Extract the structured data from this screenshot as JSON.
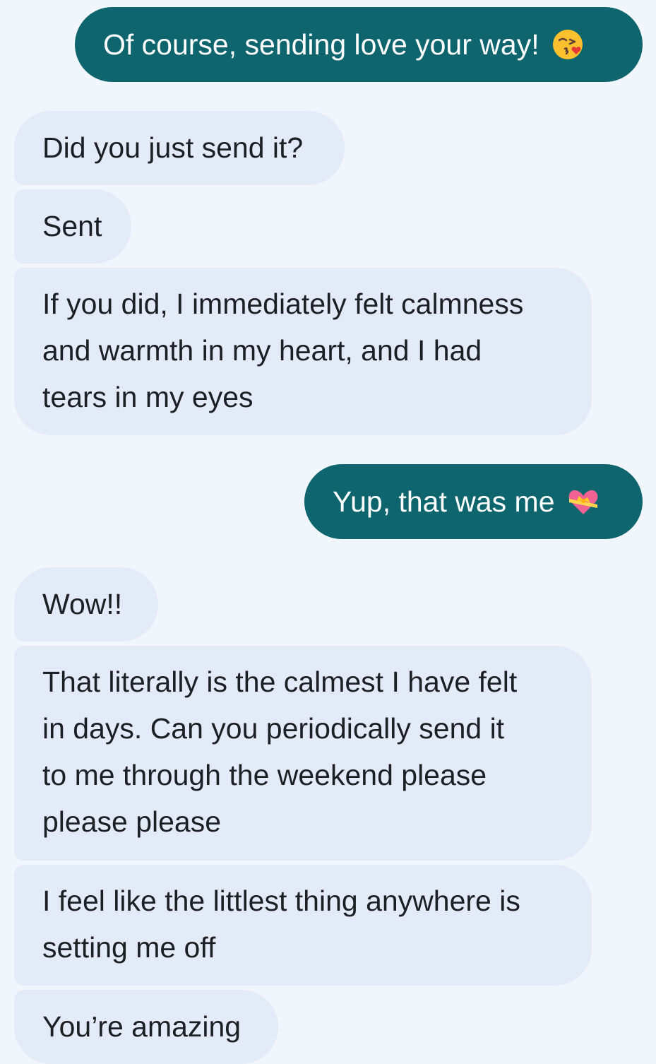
{
  "conversation": {
    "messages": [
      {
        "direction": "outgoing",
        "text": "Of course, sending love your way!",
        "emoji": "face-blowing-kiss-icon"
      },
      {
        "direction": "incoming",
        "text": "Did you just send it?"
      },
      {
        "direction": "incoming",
        "text": "Sent"
      },
      {
        "direction": "incoming",
        "lines": [
          "If you did, I immediately felt calmness",
          "and warmth in my heart, and I had",
          "tears in my eyes"
        ]
      },
      {
        "direction": "outgoing",
        "text": "Yup, that was me",
        "emoji": "heart-with-ribbon-icon"
      },
      {
        "direction": "incoming",
        "text": "Wow!!"
      },
      {
        "direction": "incoming",
        "lines": [
          "That literally is the calmest I have felt",
          "in days. Can you periodically send it",
          "to me through the weekend please",
          "please please"
        ]
      },
      {
        "direction": "incoming",
        "lines": [
          "I feel like the littlest thing anywhere is",
          "setting me off"
        ]
      },
      {
        "direction": "incoming",
        "text": "You’re amazing"
      }
    ]
  },
  "colors": {
    "background": "#f1f6fc",
    "incoming_bubble": "#e4ebf8",
    "outgoing_bubble": "#0f656e",
    "incoming_text": "#1c1f24",
    "outgoing_text": "#ffffff"
  }
}
